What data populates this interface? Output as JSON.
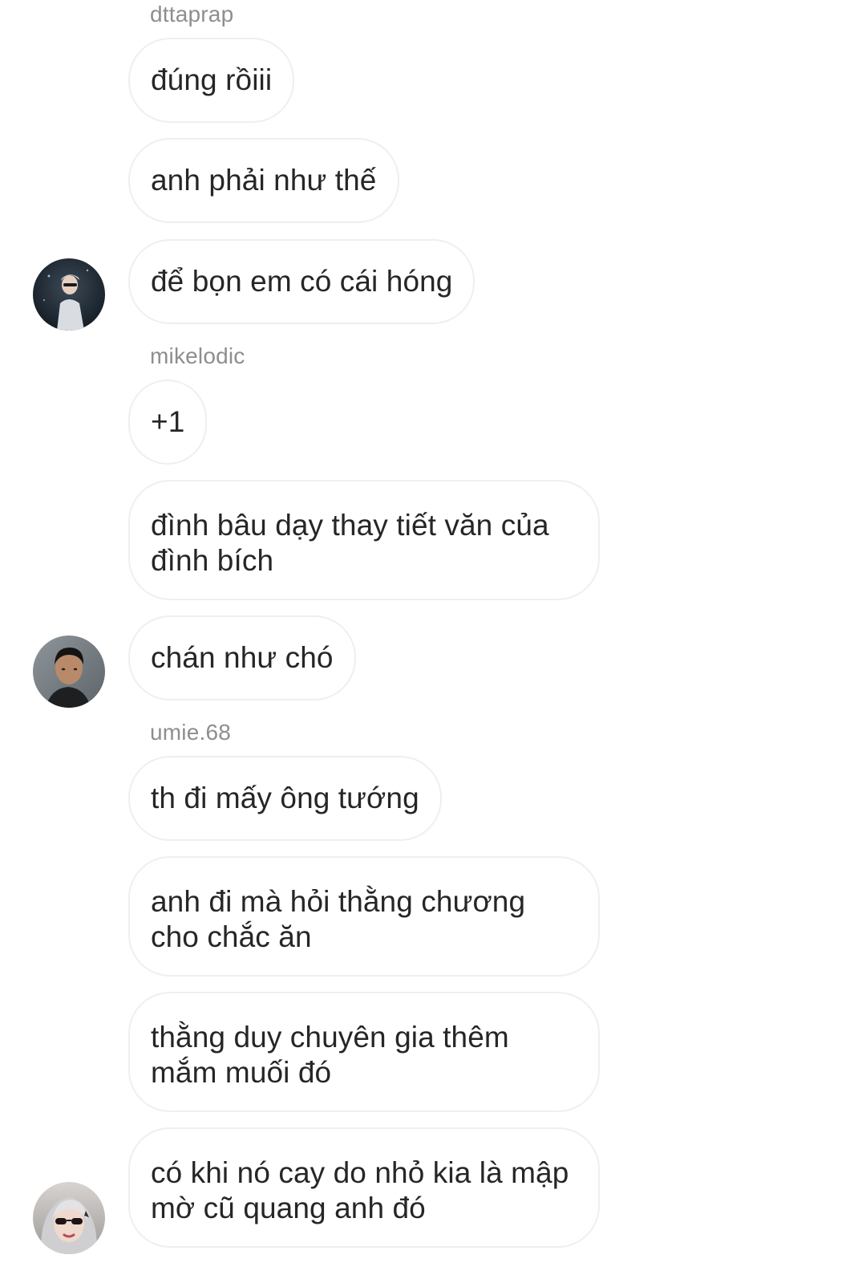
{
  "thread": {
    "groups": [
      {
        "sender": "dttaprap",
        "avatar_icon": "user-photo-icon",
        "messages": [
          "đúng rồiii",
          "anh phải như thế",
          "để bọn em có cái hóng"
        ]
      },
      {
        "sender": "mikelodic",
        "avatar_icon": "user-photo-icon",
        "messages": [
          "+1",
          "đình bâu dạy thay tiết văn của\nđình bích",
          "chán như chó"
        ]
      },
      {
        "sender": "umie.68",
        "avatar_icon": "user-photo-icon",
        "messages": [
          "th đi mấy ông tướng",
          "anh đi mà hỏi thằng chương\ncho chắc ăn",
          "thằng duy chuyên gia thêm\nmắm muối đó",
          "có khi nó cay do nhỏ kia là mập\nmờ cũ quang anh đó"
        ]
      }
    ]
  },
  "colors": {
    "bubble_border": "#efefef",
    "username": "#8e8e8e",
    "text": "#262626",
    "background": "#ffffff"
  }
}
